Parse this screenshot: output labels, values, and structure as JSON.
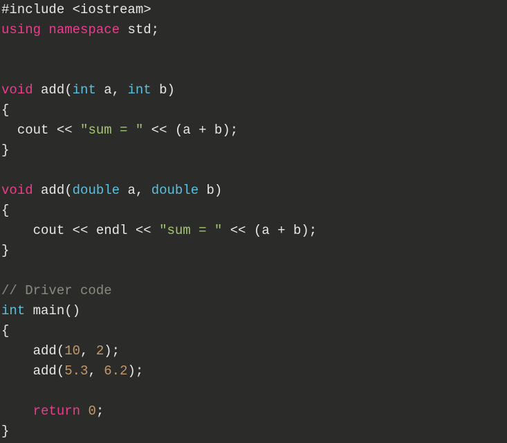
{
  "code": {
    "language": "cpp",
    "lines": [
      [
        {
          "t": "preproc",
          "v": "#include <iostream>"
        }
      ],
      [
        {
          "t": "keyword",
          "v": "using"
        },
        {
          "t": "default",
          "v": " "
        },
        {
          "t": "keyword",
          "v": "namespace"
        },
        {
          "t": "default",
          "v": " "
        },
        {
          "t": "ident",
          "v": "std"
        },
        {
          "t": "punct",
          "v": ";"
        }
      ],
      [],
      [],
      [
        {
          "t": "keyword",
          "v": "void"
        },
        {
          "t": "default",
          "v": " "
        },
        {
          "t": "ident",
          "v": "add"
        },
        {
          "t": "paren",
          "v": "("
        },
        {
          "t": "type",
          "v": "int"
        },
        {
          "t": "default",
          "v": " "
        },
        {
          "t": "ident",
          "v": "a"
        },
        {
          "t": "punct",
          "v": ","
        },
        {
          "t": "default",
          "v": " "
        },
        {
          "t": "type",
          "v": "int"
        },
        {
          "t": "default",
          "v": " "
        },
        {
          "t": "ident",
          "v": "b"
        },
        {
          "t": "paren",
          "v": ")"
        }
      ],
      [
        {
          "t": "brace",
          "v": "{"
        }
      ],
      [
        {
          "t": "default",
          "v": "  "
        },
        {
          "t": "ident",
          "v": "cout"
        },
        {
          "t": "default",
          "v": " "
        },
        {
          "t": "op",
          "v": "<<"
        },
        {
          "t": "default",
          "v": " "
        },
        {
          "t": "string",
          "v": "\"sum = \""
        },
        {
          "t": "default",
          "v": " "
        },
        {
          "t": "op",
          "v": "<<"
        },
        {
          "t": "default",
          "v": " "
        },
        {
          "t": "paren",
          "v": "("
        },
        {
          "t": "ident",
          "v": "a"
        },
        {
          "t": "default",
          "v": " "
        },
        {
          "t": "op",
          "v": "+"
        },
        {
          "t": "default",
          "v": " "
        },
        {
          "t": "ident",
          "v": "b"
        },
        {
          "t": "paren",
          "v": ")"
        },
        {
          "t": "punct",
          "v": ";"
        }
      ],
      [
        {
          "t": "brace",
          "v": "}"
        }
      ],
      [],
      [
        {
          "t": "keyword",
          "v": "void"
        },
        {
          "t": "default",
          "v": " "
        },
        {
          "t": "ident",
          "v": "add"
        },
        {
          "t": "paren",
          "v": "("
        },
        {
          "t": "type",
          "v": "double"
        },
        {
          "t": "default",
          "v": " "
        },
        {
          "t": "ident",
          "v": "a"
        },
        {
          "t": "punct",
          "v": ","
        },
        {
          "t": "default",
          "v": " "
        },
        {
          "t": "type",
          "v": "double"
        },
        {
          "t": "default",
          "v": " "
        },
        {
          "t": "ident",
          "v": "b"
        },
        {
          "t": "paren",
          "v": ")"
        }
      ],
      [
        {
          "t": "brace",
          "v": "{"
        }
      ],
      [
        {
          "t": "default",
          "v": "    "
        },
        {
          "t": "ident",
          "v": "cout"
        },
        {
          "t": "default",
          "v": " "
        },
        {
          "t": "op",
          "v": "<<"
        },
        {
          "t": "default",
          "v": " "
        },
        {
          "t": "ident",
          "v": "endl"
        },
        {
          "t": "default",
          "v": " "
        },
        {
          "t": "op",
          "v": "<<"
        },
        {
          "t": "default",
          "v": " "
        },
        {
          "t": "string",
          "v": "\"sum = \""
        },
        {
          "t": "default",
          "v": " "
        },
        {
          "t": "op",
          "v": "<<"
        },
        {
          "t": "default",
          "v": " "
        },
        {
          "t": "paren",
          "v": "("
        },
        {
          "t": "ident",
          "v": "a"
        },
        {
          "t": "default",
          "v": " "
        },
        {
          "t": "op",
          "v": "+"
        },
        {
          "t": "default",
          "v": " "
        },
        {
          "t": "ident",
          "v": "b"
        },
        {
          "t": "paren",
          "v": ")"
        },
        {
          "t": "punct",
          "v": ";"
        }
      ],
      [
        {
          "t": "brace",
          "v": "}"
        }
      ],
      [],
      [
        {
          "t": "comment",
          "v": "// Driver code"
        }
      ],
      [
        {
          "t": "type",
          "v": "int"
        },
        {
          "t": "default",
          "v": " "
        },
        {
          "t": "ident",
          "v": "main"
        },
        {
          "t": "paren",
          "v": "()"
        }
      ],
      [
        {
          "t": "brace",
          "v": "{"
        }
      ],
      [
        {
          "t": "default",
          "v": "    "
        },
        {
          "t": "ident",
          "v": "add"
        },
        {
          "t": "paren",
          "v": "("
        },
        {
          "t": "number",
          "v": "10"
        },
        {
          "t": "punct",
          "v": ","
        },
        {
          "t": "default",
          "v": " "
        },
        {
          "t": "number",
          "v": "2"
        },
        {
          "t": "paren",
          "v": ")"
        },
        {
          "t": "punct",
          "v": ";"
        }
      ],
      [
        {
          "t": "default",
          "v": "    "
        },
        {
          "t": "ident",
          "v": "add"
        },
        {
          "t": "paren",
          "v": "("
        },
        {
          "t": "number",
          "v": "5.3"
        },
        {
          "t": "punct",
          "v": ","
        },
        {
          "t": "default",
          "v": " "
        },
        {
          "t": "number",
          "v": "6.2"
        },
        {
          "t": "paren",
          "v": ")"
        },
        {
          "t": "punct",
          "v": ";"
        }
      ],
      [],
      [
        {
          "t": "default",
          "v": "    "
        },
        {
          "t": "keyword",
          "v": "return"
        },
        {
          "t": "default",
          "v": " "
        },
        {
          "t": "number",
          "v": "0"
        },
        {
          "t": "punct",
          "v": ";"
        }
      ],
      [
        {
          "t": "brace",
          "v": "}"
        }
      ]
    ]
  }
}
